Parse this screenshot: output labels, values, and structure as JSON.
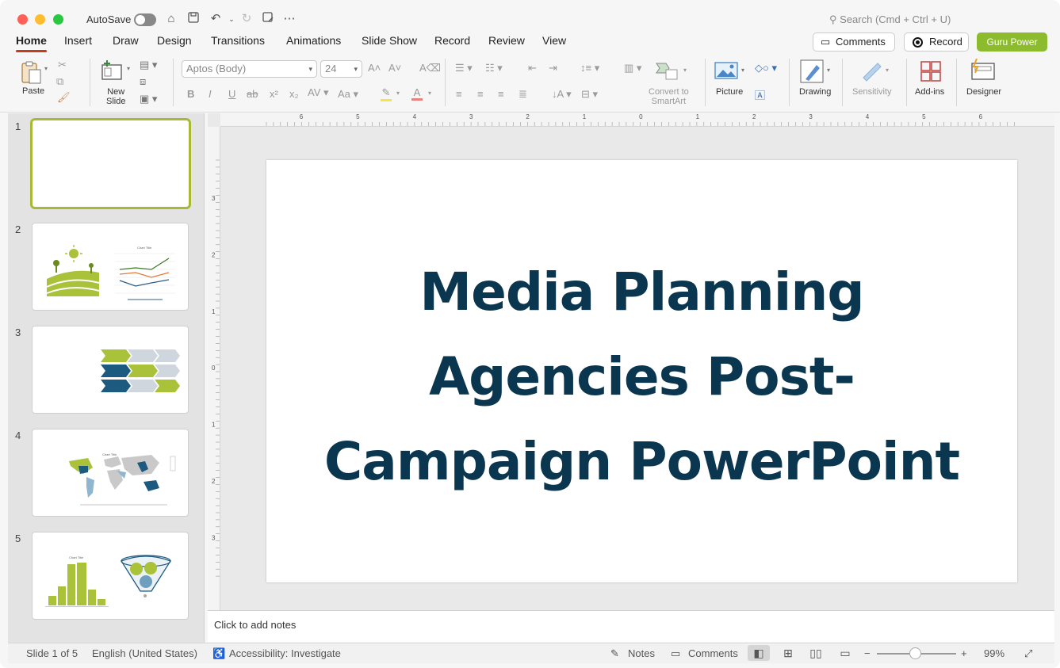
{
  "titlebar": {
    "autosave_label": "AutoSave",
    "search_placeholder": "Search (Cmd + Ctrl + U)"
  },
  "menu": {
    "tabs": [
      "Home",
      "Insert",
      "Draw",
      "Design",
      "Transitions",
      "Animations",
      "Slide Show",
      "Record",
      "Review",
      "View"
    ],
    "active_tab": "Home",
    "comments_label": "Comments",
    "record_label": "Record",
    "guru_label": "Guru Power"
  },
  "ribbon": {
    "paste_label": "Paste",
    "new_slide_label": "New\nSlide",
    "font_name": "Aptos (Body)",
    "font_size": "24",
    "convert_label": "Convert to\nSmartArt",
    "picture_label": "Picture",
    "drawing_label": "Drawing",
    "sensitivity_label": "Sensitivity",
    "addins_label": "Add-ins",
    "designer_label": "Designer"
  },
  "thumbnails": {
    "numbers": [
      "1",
      "2",
      "3",
      "4",
      "5"
    ],
    "chart_title_small": "Chart Title"
  },
  "ruler": {
    "h_labels": [
      "6",
      "5",
      "4",
      "3",
      "2",
      "1",
      "0",
      "1",
      "2",
      "3",
      "4",
      "5",
      "6"
    ],
    "v_labels": [
      "3",
      "2",
      "1",
      "0",
      "1",
      "2",
      "3"
    ]
  },
  "slide": {
    "title_lines": [
      "Media Planning",
      "Agencies Post-",
      "Campaign PowerPoint"
    ]
  },
  "notes": {
    "placeholder": "Click to add notes"
  },
  "status": {
    "slide_counter": "Slide 1 of 5",
    "language": "English (United States)",
    "accessibility": "Accessibility: Investigate",
    "notes_label": "Notes",
    "comments_label": "Comments",
    "zoom_level": "99%"
  },
  "colors": {
    "title": "#0b3650",
    "accent_green": "#a9c23a",
    "accent_blue": "#1d5a80",
    "tab_underline": "#c43e1c",
    "guru_button": "#8dbb2e"
  }
}
